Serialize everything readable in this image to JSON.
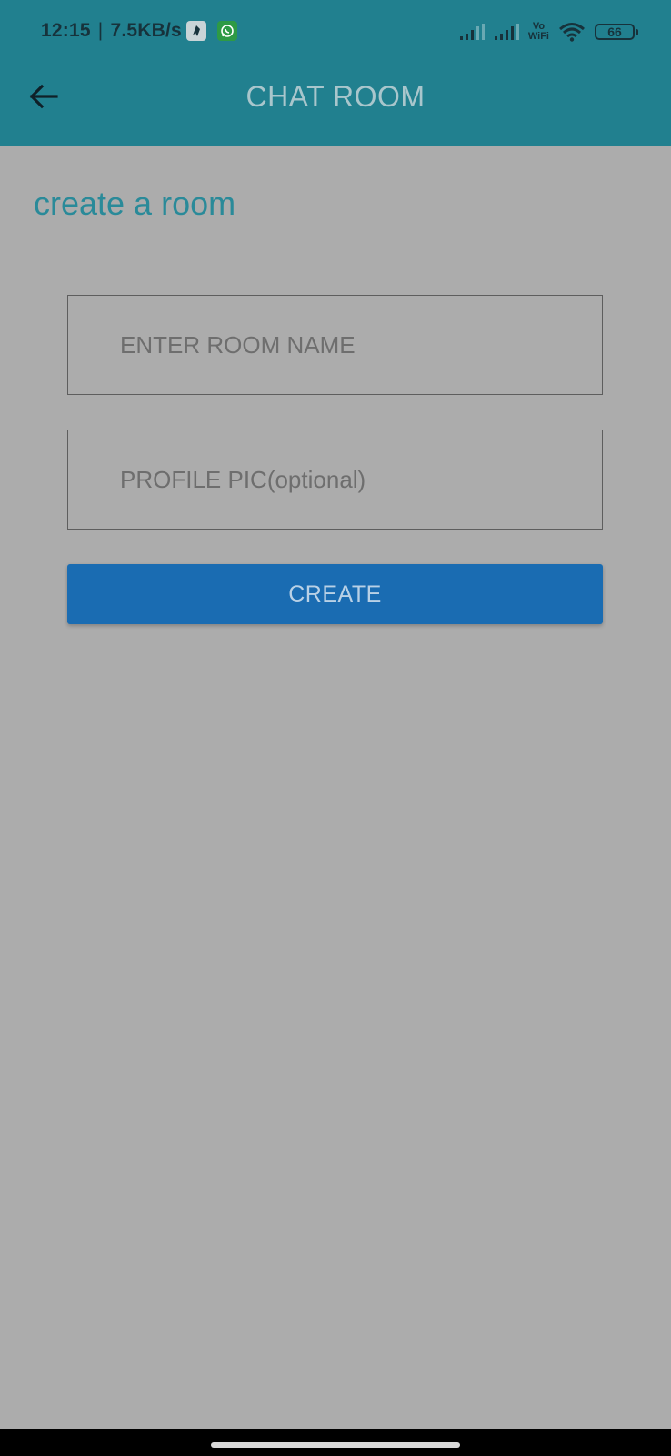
{
  "status_bar": {
    "time": "12:15",
    "separator": "|",
    "network_speed": "7.5KB/s",
    "notification_icons": [
      "telegram-icon",
      "whatsapp-icon"
    ],
    "vowifi_top": "Vo",
    "vowifi_bottom": "WiFi",
    "battery_level": "66"
  },
  "app_bar": {
    "title": "CHAT ROOM",
    "back_icon": "arrow-left-icon"
  },
  "main": {
    "heading": "create a room",
    "room_name_placeholder": "ENTER ROOM NAME",
    "room_name_value": "",
    "profile_pic_placeholder": "PROFILE PIC(optional)",
    "profile_pic_value": "",
    "create_label": "CREATE"
  },
  "colors": {
    "app_bar": "#21808f",
    "background": "#acacac",
    "heading": "#2a8a99",
    "create_button": "#1a6cb2"
  }
}
